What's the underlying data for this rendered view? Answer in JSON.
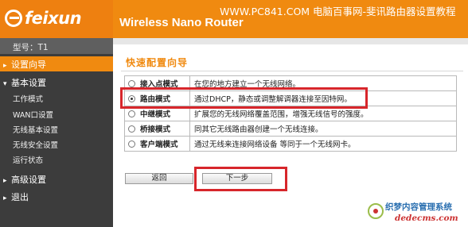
{
  "header": {
    "brand": "feixun",
    "product": "Wireless Nano Router",
    "watermark": "WWW.PC841.COM 电脑百事网-斐讯路由器设置教程"
  },
  "model_label": "型号：T1",
  "sidebar": {
    "items": [
      {
        "label": "设置向导",
        "arrow": "▸",
        "active": true
      },
      {
        "label": "基本设置",
        "arrow": "▾",
        "active": false
      },
      {
        "label": "工作模式"
      },
      {
        "label": "WAN口设置"
      },
      {
        "label": "无线基本设置"
      },
      {
        "label": "无线安全设置"
      },
      {
        "label": "运行状态"
      },
      {
        "label": "高级设置",
        "arrow": "▸",
        "active": false
      },
      {
        "label": "退出",
        "arrow": "▸",
        "active": false
      }
    ]
  },
  "wizard": {
    "title": "快速配置向导",
    "selected_mode": "路由模式",
    "modes": [
      {
        "label": "接入点模式",
        "desc": "在您的地方建立一个无线网络。",
        "selected": false
      },
      {
        "label": "路由模式",
        "desc": "通过DHCP，静态或调整解调器连接至因特网。",
        "selected": true
      },
      {
        "label": "中继模式",
        "desc": "扩展您的无线网络覆盖范围，增强无线信号的强度。",
        "selected": false
      },
      {
        "label": "桥接模式",
        "desc": "同其它无线路由器创建一个无线连接。",
        "selected": false
      },
      {
        "label": "客户端模式",
        "desc": "通过无线来连接网络设备 等同于一个无线网卡。",
        "selected": false
      }
    ],
    "back_label": "返回",
    "next_label": "下一步"
  },
  "watermark_bottom": {
    "line1": "织梦内容管理系统",
    "line2": "dedecms.com"
  },
  "colors": {
    "accent": "#f08a10",
    "sidebar_bg": "#3c3c3c",
    "highlight": "#d7262b"
  }
}
